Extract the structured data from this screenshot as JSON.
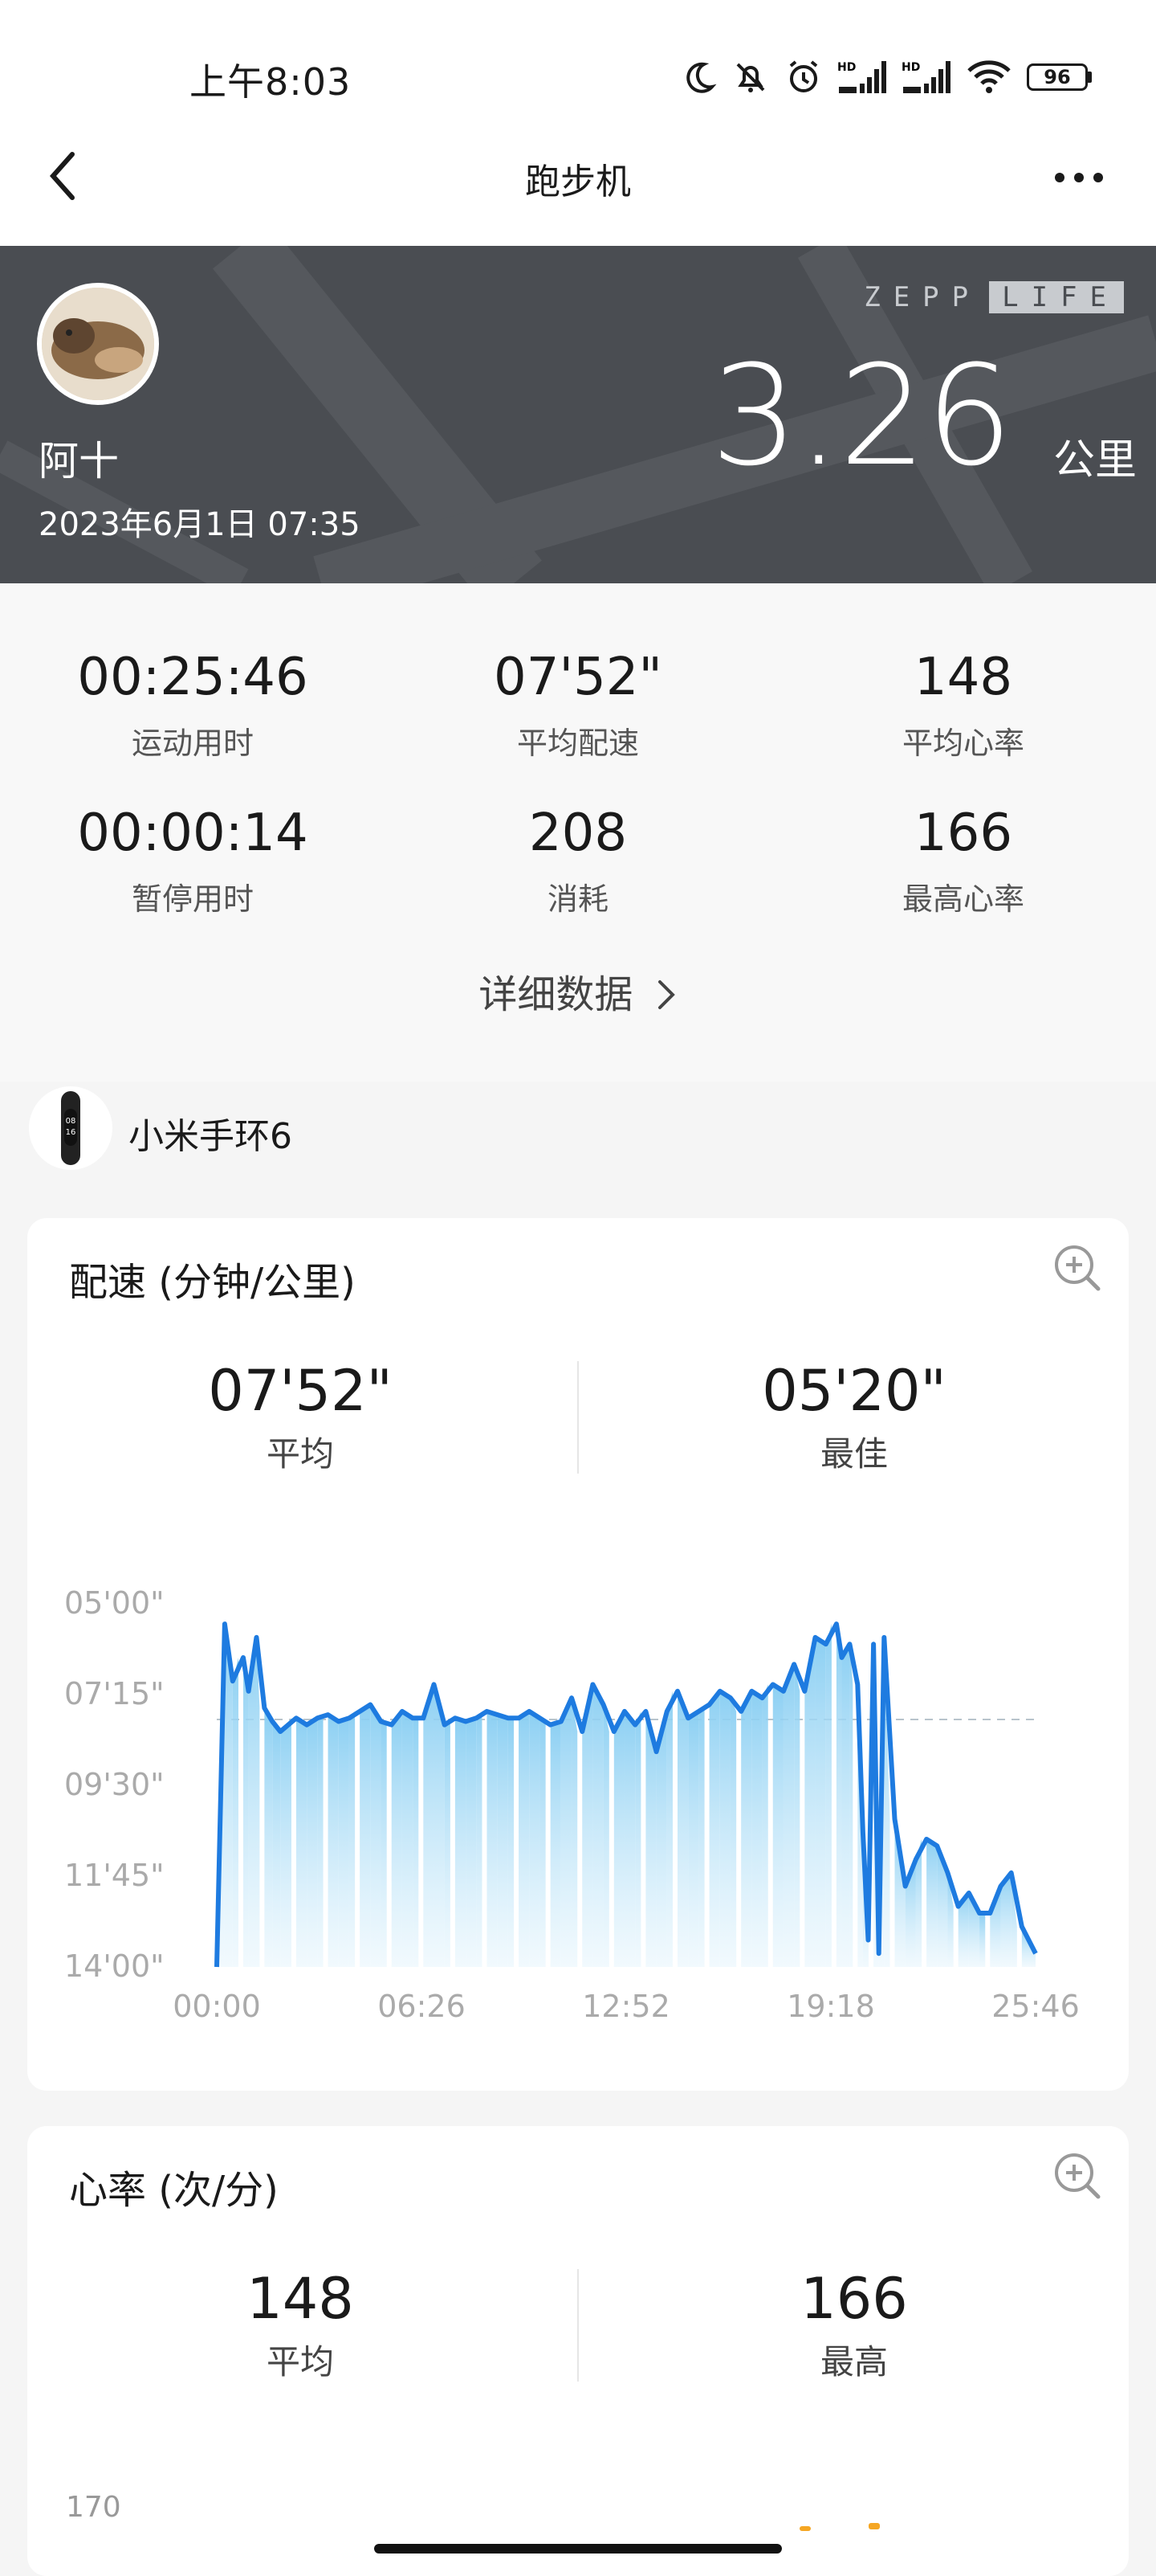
{
  "status_bar": {
    "time": "上午8:03",
    "battery": "96"
  },
  "nav": {
    "title": "跑步机"
  },
  "hero": {
    "user_name": "阿十",
    "date": "2023年6月1日 07:35",
    "brand_left": "ZEPP",
    "brand_right": "LIFE",
    "distance": "3.26",
    "distance_unit": "公里"
  },
  "stats": [
    {
      "value": "00:25:46",
      "label": "运动用时"
    },
    {
      "value": "07'52\"",
      "label": "平均配速"
    },
    {
      "value": "148",
      "label": "平均心率"
    },
    {
      "value": "00:00:14",
      "label": "暂停用时"
    },
    {
      "value": "208",
      "label": "消耗"
    },
    {
      "value": "166",
      "label": "最高心率"
    }
  ],
  "details_link": "详细数据",
  "device": {
    "name": "小米手环6",
    "band_time_top": "08",
    "band_time_bottom": "16"
  },
  "pace_card": {
    "title": "配速 (分钟/公里)",
    "avg_value": "07'52\"",
    "avg_label": "平均",
    "best_value": "05'20\"",
    "best_label": "最佳"
  },
  "heart_card": {
    "title": "心率 (次/分)",
    "avg_value": "148",
    "avg_label": "平均",
    "max_value": "166",
    "max_label": "最高",
    "y_top_label": "170"
  },
  "chart_data": {
    "type": "area",
    "title": "",
    "xlabel": "",
    "ylabel": "",
    "x_ticks": [
      "00:00",
      "06:26",
      "12:52",
      "19:18",
      "25:46"
    ],
    "y_ticks": [
      "05'00\"",
      "07'15\"",
      "09'30\"",
      "11'45\"",
      "14'00\""
    ],
    "y_inverted": true,
    "ylim_seconds": [
      300,
      840
    ],
    "average_line_seconds": 472,
    "grid": false,
    "series": [
      {
        "x_seconds": [
          0,
          15,
          30,
          50,
          60,
          75,
          90,
          105,
          120,
          150,
          170,
          190,
          210,
          230,
          250,
          270,
          290,
          310,
          330,
          350,
          370,
          390,
          410,
          430,
          450,
          470,
          490,
          510,
          530,
          550,
          570,
          590,
          610,
          630,
          650,
          670,
          690,
          710,
          730,
          750,
          770,
          790,
          810,
          830,
          850,
          870,
          890,
          910,
          930,
          950,
          970,
          990,
          1010,
          1030,
          1050,
          1070,
          1090,
          1110,
          1130,
          1150,
          1170,
          1180,
          1195,
          1210,
          1220,
          1230,
          1240,
          1250,
          1260,
          1280,
          1300,
          1320,
          1340,
          1360,
          1380,
          1400,
          1420,
          1440,
          1460,
          1480,
          1500,
          1520,
          1546
        ],
        "y_seconds": [
          840,
          330,
          415,
          380,
          430,
          350,
          455,
          475,
          490,
          470,
          480,
          470,
          465,
          475,
          470,
          460,
          450,
          475,
          480,
          460,
          470,
          470,
          420,
          480,
          470,
          475,
          470,
          460,
          465,
          470,
          470,
          460,
          470,
          480,
          475,
          440,
          490,
          420,
          450,
          490,
          460,
          480,
          460,
          520,
          460,
          430,
          470,
          460,
          450,
          430,
          440,
          460,
          430,
          440,
          420,
          430,
          390,
          430,
          350,
          360,
          330,
          380,
          360,
          420,
          640,
          800,
          360,
          820,
          350,
          620,
          720,
          680,
          650,
          660,
          700,
          750,
          730,
          760,
          760,
          720,
          700,
          780,
          820
        ]
      }
    ]
  }
}
